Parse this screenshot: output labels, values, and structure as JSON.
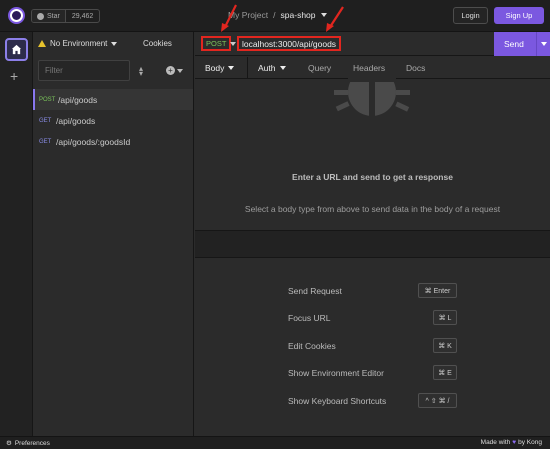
{
  "header": {
    "github_star_label": "Star",
    "github_star_count": "29,462",
    "breadcrumb_project": "My Project",
    "breadcrumb_separator": "/",
    "breadcrumb_workspace": "spa-shop",
    "login_label": "Login",
    "signup_label": "Sign Up"
  },
  "sidebar": {
    "environment": "No Environment",
    "cookies": "Cookies",
    "filter_placeholder": "Filter",
    "requests": [
      {
        "method": "POST",
        "path": "/api/goods",
        "active": true
      },
      {
        "method": "GET",
        "path": "/api/goods",
        "active": false
      },
      {
        "method": "GET",
        "path": "/api/goods/:goodsId",
        "active": false
      }
    ]
  },
  "request": {
    "method": "POST",
    "url": "localhost:3000/api/goods",
    "send_label": "Send",
    "tabs": [
      "Body",
      "Auth",
      "Query",
      "Headers",
      "Docs"
    ]
  },
  "empty_state": {
    "title": "Enter a URL and send to get a response",
    "subtitle": "Select a body type from above to send data in the body of a request"
  },
  "shortcuts": [
    {
      "label": "Send Request",
      "keys": "⌘ Enter"
    },
    {
      "label": "Focus URL",
      "keys": "⌘ L"
    },
    {
      "label": "Edit Cookies",
      "keys": "⌘ K"
    },
    {
      "label": "Show Environment Editor",
      "keys": "⌘ E"
    },
    {
      "label": "Show Keyboard Shortcuts",
      "keys": "^ ⇧ ⌘ /"
    }
  ],
  "footer": {
    "preferences": "Preferences",
    "made_with": "Made with",
    "by": "by Kong"
  },
  "colors": {
    "accent": "#7b58e0",
    "annotation_red": "#e2261f",
    "post_method": "#7ac45a",
    "get_method": "#8a8de8"
  }
}
